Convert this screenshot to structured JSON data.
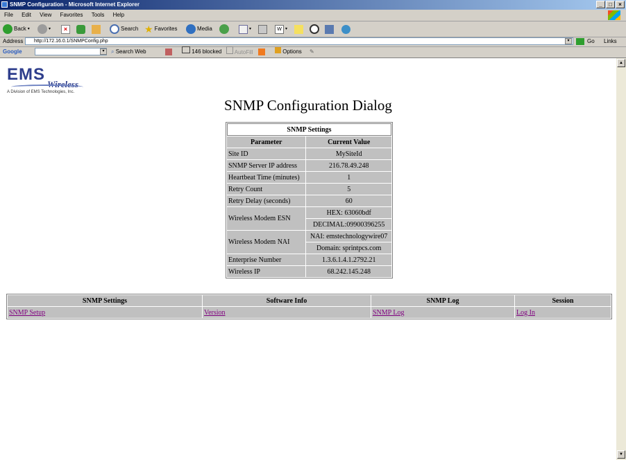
{
  "window": {
    "title": "SNMP Configuration - Microsoft Internet Explorer"
  },
  "menu": [
    "File",
    "Edit",
    "View",
    "Favorites",
    "Tools",
    "Help"
  ],
  "toolbar": {
    "back": "Back",
    "search": "Search",
    "favorites": "Favorites",
    "media": "Media"
  },
  "address": {
    "label": "Address",
    "url": "http://172.16.0.1/SNMPConfig.php",
    "go": "Go",
    "links": "Links"
  },
  "googlebar": {
    "brand": "Google",
    "search_web": "Search Web",
    "blocked": "146 blocked",
    "autofill": "AutoFill",
    "options": "Options"
  },
  "logo": {
    "brand": "EMS",
    "sub": "Wireless",
    "division": "A Division of EMS Technologies, Inc."
  },
  "page": {
    "title": "SNMP Configuration Dialog"
  },
  "settings": {
    "caption": "SNMP Settings",
    "headers": {
      "parameter": "Parameter",
      "value": "Current Value"
    },
    "site_id": {
      "label": "Site ID",
      "value": "MySiteId"
    },
    "server_ip": {
      "label": "SNMP Server IP address",
      "value": "216.78.49.248"
    },
    "heartbeat": {
      "label": "Heartbeat Time (minutes)",
      "value": "1"
    },
    "retry_count": {
      "label": "Retry Count",
      "value": "5"
    },
    "retry_delay": {
      "label": "Retry Delay (seconds)",
      "value": "60"
    },
    "esn": {
      "label": "Wireless Modem ESN",
      "hex": "HEX: 63060bdf",
      "decimal": "DECIMAL:09900396255"
    },
    "nai": {
      "label": "Wireless Modem NAI",
      "nai": "NAI: emstechnologywire07",
      "domain": "Domain: sprintpcs.com"
    },
    "enterprise": {
      "label": "Enterprise Number",
      "value": "1.3.6.1.4.1.2792.21"
    },
    "wireless_ip": {
      "label": "Wireless IP",
      "value": "68.242.145.248"
    }
  },
  "nav": {
    "headers": [
      "SNMP Settings",
      "Software Info",
      "SNMP Log",
      "Session"
    ],
    "links": [
      "SNMP Setup",
      "Version",
      "SNMP Log",
      "Log In"
    ]
  }
}
